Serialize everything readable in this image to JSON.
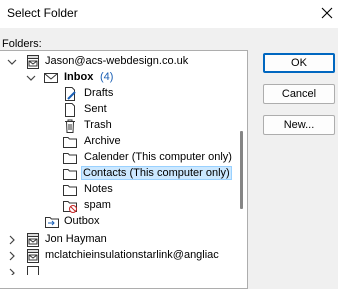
{
  "window": {
    "title": "Select Folder"
  },
  "folders_label": "Folders:",
  "tree": {
    "account": "Jason@acs-webdesign.co.uk",
    "inbox": {
      "label": "Inbox",
      "count": "(4)"
    },
    "items": [
      {
        "label": "Drafts",
        "icon": "drafts-icon"
      },
      {
        "label": "Sent",
        "icon": "sent-icon"
      },
      {
        "label": "Trash",
        "icon": "trash-icon"
      },
      {
        "label": "Archive",
        "icon": "folder-icon"
      },
      {
        "label": "Calender (This computer only)",
        "icon": "folder-icon"
      },
      {
        "label": "Contacts (This computer only)",
        "icon": "folder-icon",
        "selected": true
      },
      {
        "label": "Notes",
        "icon": "folder-icon"
      },
      {
        "label": "spam",
        "icon": "junk-icon"
      }
    ],
    "outbox": "Outbox",
    "other_accounts": [
      "Jon Hayman",
      "mclatchieinsulationstarlink@angliac"
    ]
  },
  "buttons": {
    "ok": "OK",
    "cancel": "Cancel",
    "new": "New..."
  },
  "colors": {
    "accent": "#0067c0",
    "selection": "#cce8ff",
    "count": "#1a5fb4"
  }
}
